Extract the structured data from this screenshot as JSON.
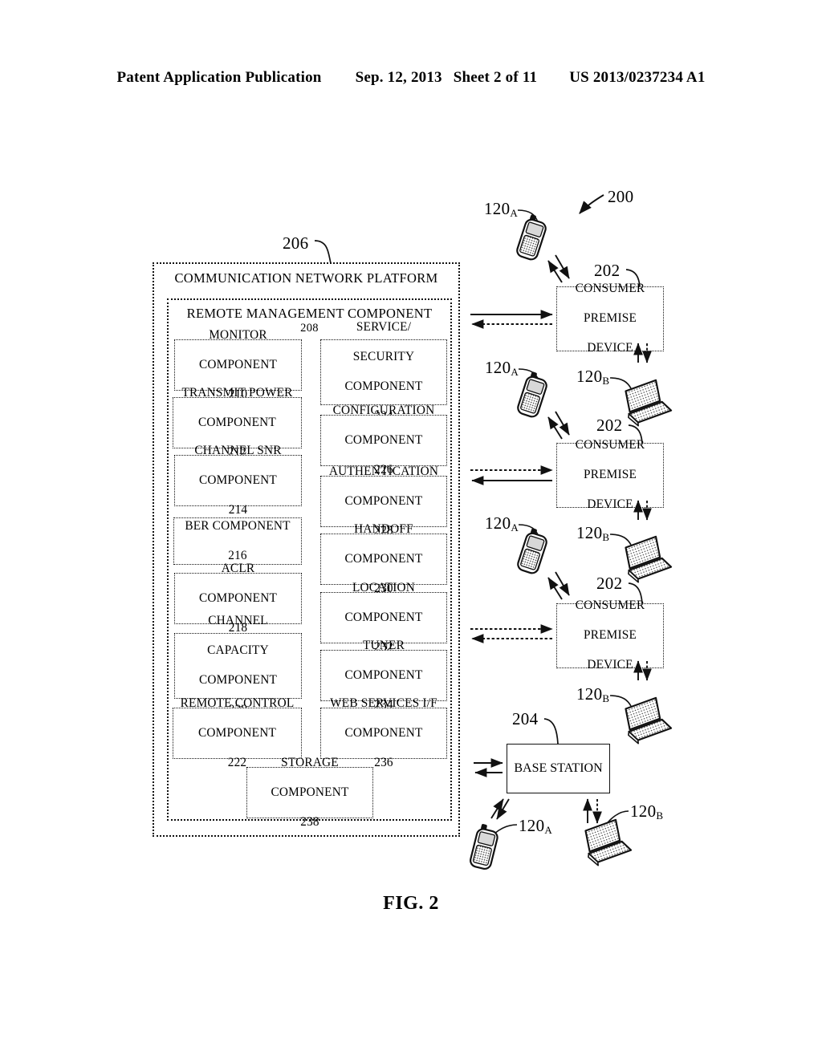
{
  "header": {
    "publication": "Patent Application Publication",
    "date": "Sep. 12, 2013",
    "sheet": "Sheet 2 of 11",
    "patent_number": "US 2013/0237234 A1"
  },
  "figure": {
    "caption": "FIG. 2",
    "system_ref": "200"
  },
  "platform": {
    "title": "COMMUNICATION NETWORK PLATFORM",
    "ref": "206",
    "remote_management": {
      "title": "REMOTE MANAGEMENT COMPONENT",
      "ref": "208"
    },
    "left_components": [
      {
        "name": "MONITOR\nCOMPONENT",
        "line1": "MONITOR",
        "line2": "COMPONENT",
        "ref": "210"
      },
      {
        "name": "TRANSMIT POWER\nCOMPONENT",
        "line1": "TRANSMIT POWER",
        "line2": "COMPONENT",
        "ref": "212"
      },
      {
        "name": "CHANNEL SNR\nCOMPONENT",
        "line1": "CHANNEL SNR",
        "line2": "COMPONENT",
        "ref": "214"
      },
      {
        "name": "BER COMPONENT",
        "line1": "BER COMPONENT",
        "line2": "",
        "ref": "216"
      },
      {
        "name": "ACLR\nCOMPONENT",
        "line1": "ACLR",
        "line2": "COMPONENT",
        "ref": "218"
      },
      {
        "name": "CHANNEL CAPACITY COMPONENT",
        "line1": "CHANNEL",
        "line2": "CAPACITY",
        "line3": "COMPONENT",
        "ref": "220"
      },
      {
        "name": "REMOTE CONTROL\nCOMPONENT",
        "line1": "REMOTE CONTROL",
        "line2": "COMPONENT",
        "ref": "222"
      }
    ],
    "right_components": [
      {
        "name": "SERVICE/ SECURITY COMPONENT",
        "line1": "SERVICE/",
        "line2": "SECURITY",
        "line3": "COMPONENT",
        "ref": "224"
      },
      {
        "name": "CONFIGURATION\nCOMPONENT",
        "line1": "CONFIGURATION",
        "line2": "COMPONENT",
        "ref": "226"
      },
      {
        "name": "AUTHENTICATION\nCOMPONENT",
        "line1": "AUTHENTICATION",
        "line2": "COMPONENT",
        "ref": "228"
      },
      {
        "name": "HANDOFF\nCOMPONENT",
        "line1": "HANDOFF",
        "line2": "COMPONENT",
        "ref": "230"
      },
      {
        "name": "LOCATION\nCOMPONENT",
        "line1": "LOCATION",
        "line2": "COMPONENT",
        "ref": "232"
      },
      {
        "name": "TUNER\nCOMPONENT",
        "line1": "TUNER",
        "line2": "COMPONENT",
        "ref": "234"
      },
      {
        "name": "WEB SERVICES I/F\nCOMPONENT",
        "line1": "WEB SERVICES I/F",
        "line2": "COMPONENT",
        "ref": "236"
      }
    ],
    "storage_component": {
      "line1": "STORAGE",
      "line2": "COMPONENT",
      "ref": "238"
    }
  },
  "network": {
    "cpe_label_line1": "CONSUMER",
    "cpe_label_line2": "PREMISE",
    "cpe_label_line3": "DEVICE",
    "cpe_ref": "202",
    "base_station_label": "BASE STATION",
    "base_station_ref": "204",
    "mobile_ref": "120",
    "mobile_sub": "A",
    "laptop_ref": "120",
    "laptop_sub": "B"
  }
}
